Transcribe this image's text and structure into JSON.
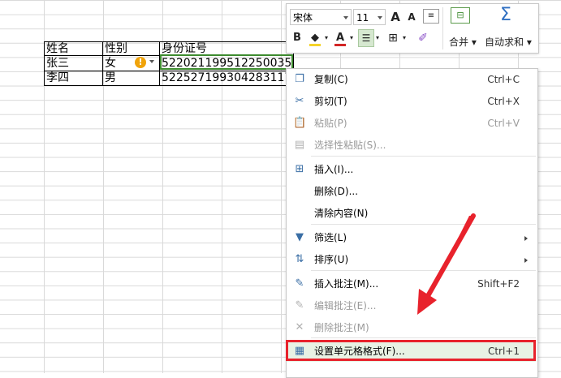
{
  "table": {
    "headers": [
      "姓名",
      "性别",
      "身份证号"
    ],
    "rows": [
      [
        "张三",
        "女",
        "522021199512250035"
      ],
      [
        "李四",
        "男",
        "522527199304283117"
      ]
    ]
  },
  "warning_icon": "!",
  "mini_toolbar": {
    "font_name": "宋体",
    "font_size": "11",
    "grow_font": "A",
    "shrink_font": "A",
    "bold": "B",
    "font_color_letter": "A",
    "merge_label": "合并",
    "autosum_label": "自动求和",
    "sigma": "Σ",
    "colors": {
      "fill": "#f5d328",
      "font": "#d22626"
    }
  },
  "context_menu": {
    "items": [
      {
        "label": "复制(C)",
        "shortcut": "Ctrl+C",
        "icon": "copy-icon",
        "glyph": "❐",
        "disabled": false
      },
      {
        "label": "剪切(T)",
        "shortcut": "Ctrl+X",
        "icon": "cut-icon",
        "glyph": "✂",
        "disabled": false
      },
      {
        "label": "粘贴(P)",
        "shortcut": "Ctrl+V",
        "icon": "paste-icon",
        "glyph": "📋",
        "disabled": true
      },
      {
        "label": "选择性粘贴(S)...",
        "shortcut": "",
        "icon": "paste-special-icon",
        "glyph": "▤",
        "disabled": true
      },
      {
        "label": "插入(I)...",
        "shortcut": "",
        "icon": "insert-icon",
        "glyph": "⊞",
        "disabled": false
      },
      {
        "label": "删除(D)...",
        "shortcut": "",
        "icon": "",
        "glyph": "",
        "disabled": false
      },
      {
        "label": "清除内容(N)",
        "shortcut": "",
        "icon": "",
        "glyph": "",
        "disabled": false
      },
      {
        "label": "筛选(L)",
        "shortcut": "",
        "icon": "filter-icon",
        "glyph": "▼",
        "disabled": false,
        "submenu": true
      },
      {
        "label": "排序(U)",
        "shortcut": "",
        "icon": "sort-icon",
        "glyph": "⇅",
        "disabled": false,
        "submenu": true
      },
      {
        "label": "插入批注(M)...",
        "shortcut": "Shift+F2",
        "icon": "insert-comment-icon",
        "glyph": "✎",
        "disabled": false
      },
      {
        "label": "编辑批注(E)...",
        "shortcut": "",
        "icon": "edit-comment-icon",
        "glyph": "✎",
        "disabled": true
      },
      {
        "label": "删除批注(M)",
        "shortcut": "",
        "icon": "delete-comment-icon",
        "glyph": "✕",
        "disabled": true
      },
      {
        "label": "设置单元格格式(F)...",
        "shortcut": "Ctrl+1",
        "icon": "format-cells-icon",
        "glyph": "▦",
        "disabled": false,
        "highlighted": true
      }
    ]
  },
  "highlight_color": "#e8222c",
  "selection_color": "#3d8b2f"
}
